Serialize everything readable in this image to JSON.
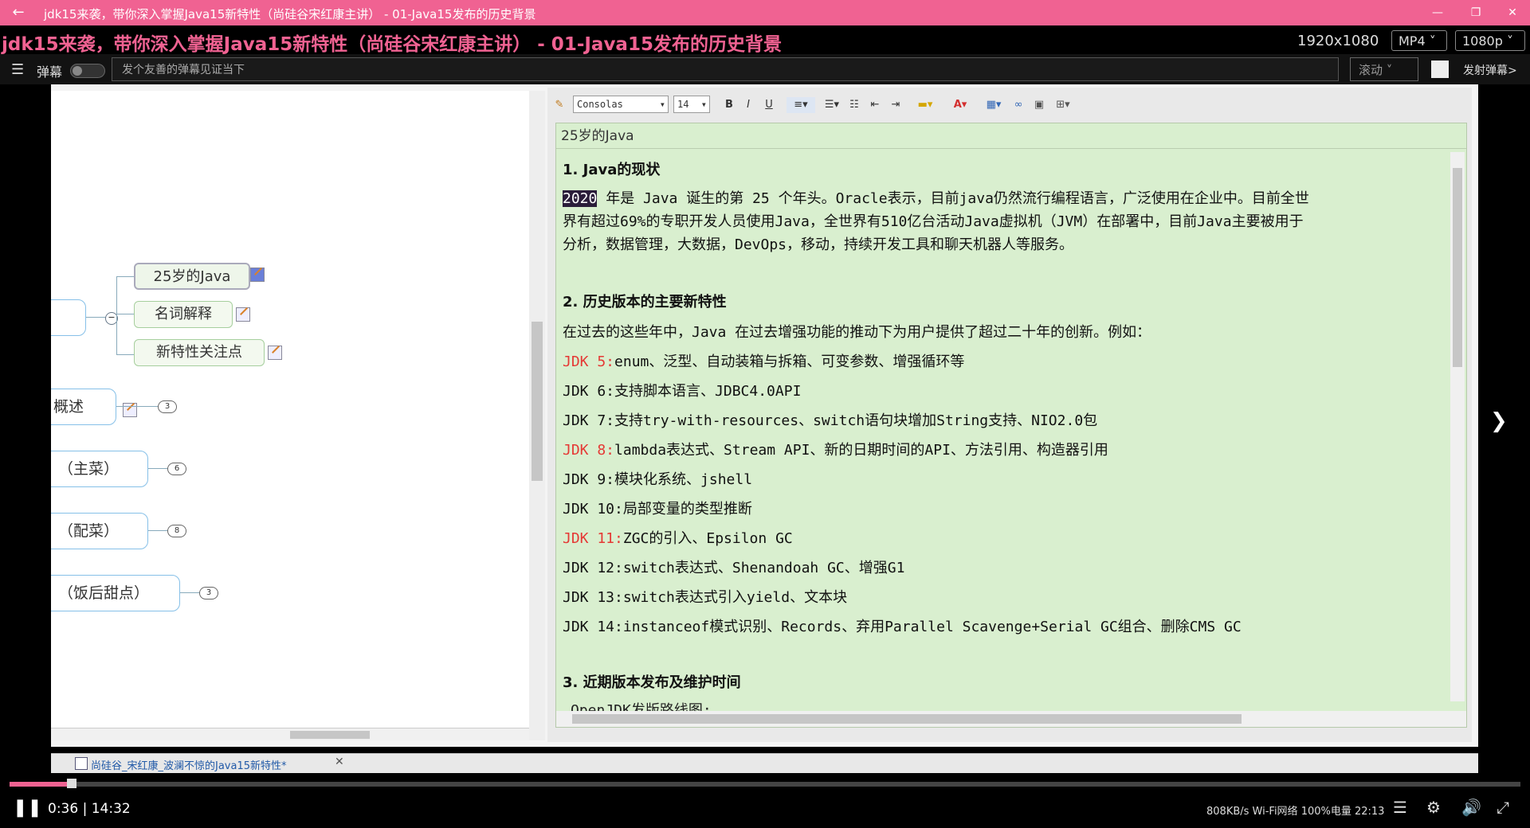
{
  "player": {
    "window_title": "jdk15来袭，带你深入掌握Java15新特性（尚硅谷宋红康主讲） - 01-Java15发布的历史背景",
    "overlay_title": "jdk15来袭，带你深入掌握Java15新特性（尚硅谷宋红康主讲） - 01-Java15发布的历史背景",
    "resolution": "1920x1080",
    "format": "MP4",
    "quality": "1080p",
    "danmaku_label": "弹幕",
    "danmaku_placeholder": "发个友善的弹幕见证当下",
    "danmaku_mode": "滚动",
    "send_label": "发射弹幕>",
    "time_current": "0:36",
    "time_total": "14:32",
    "time_sep": " | ",
    "progress": 0.041,
    "status_text": "808KB/s Wi-Fi网络 100%电量 22:13",
    "accent_color": "#f06292"
  },
  "mindmap": {
    "nodes": [
      "25岁的Java",
      "名词解释",
      "新特性关注点"
    ],
    "branches": [
      {
        "label": "概述",
        "count": "3"
      },
      {
        "label": "（主菜）",
        "count": "6"
      },
      {
        "label": "（配菜）",
        "count": "8"
      },
      {
        "label": "（饭后甜点）",
        "count": "3"
      }
    ],
    "tab_label": "尚硅谷_宋红康_波澜不惊的Java15新特性*"
  },
  "editor": {
    "font": "Consolas",
    "size": "14",
    "bold": "B",
    "italic": "I",
    "underline": "U",
    "doc_title": "25岁的Java",
    "h1": "1. Java的现状",
    "p1_year": "2020",
    "p1_a": " 年是 Java 诞生的第 25 个年头。Oracle表示，目前java仍然流行编程语言，广泛使用在企业中。目前全世",
    "p1_b": "界有超过69%的专职开发人员使用Java，全世界有510亿台活动Java虚拟机（JVM）在部署中，目前Java主要被用于",
    "p1_c": "分析，数据管理，大数据，DevOps，移动，持续开发工具和聊天机器人等服务。",
    "h2": "2. 历史版本的主要新特性",
    "p2": "在过去的这些年中，Java 在过去增强功能的推动下为用户提供了超过二十年的创新。例如：",
    "jdks": [
      {
        "ver": "JDK 5:",
        "text": "enum、泛型、自动装箱与拆箱、可变参数、增强循环等"
      },
      {
        "ver": "JDK 6:",
        "text": "支持脚本语言、JDBC4.0API"
      },
      {
        "ver": "JDK 7:",
        "text": "支持try-with-resources、switch语句块增加String支持、NIO2.0包"
      },
      {
        "ver": "JDK 8:",
        "text": "lambda表达式、Stream API、新的日期时间的API、方法引用、构造器引用"
      },
      {
        "ver": "JDK 9:",
        "text": "模块化系统、jshell"
      },
      {
        "ver": "JDK 10:",
        "text": "局部变量的类型推断"
      },
      {
        "ver": "JDK 11:",
        "text": "ZGC的引入、Epsilon GC"
      },
      {
        "ver": "JDK 12:",
        "text": "switch表达式、Shenandoah GC、增强G1"
      },
      {
        "ver": "JDK 13:",
        "text": "switch表达式引入yield、文本块"
      },
      {
        "ver": "JDK 14:",
        "text": "instanceof模式识别、Records、弃用Parallel Scavenge+Serial GC组合、删除CMS GC"
      }
    ],
    "h3": "3. 近期版本发布及维护时间",
    "p3": "OpenJDK发版路线图:"
  }
}
